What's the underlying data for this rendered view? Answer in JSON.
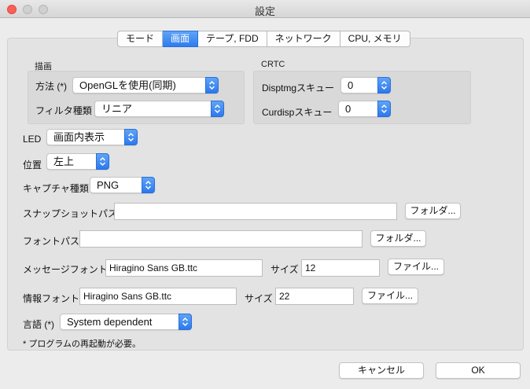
{
  "window": {
    "title": "設定"
  },
  "tabs": [
    {
      "label": "モード",
      "active": false
    },
    {
      "label": "画面",
      "active": true
    },
    {
      "label": "テープ, FDD",
      "active": false
    },
    {
      "label": "ネットワーク",
      "active": false
    },
    {
      "label": "CPU, メモリ",
      "active": false
    }
  ],
  "drawing_group": {
    "title": "描画",
    "method_label": "方法 (*)",
    "method_value": "OpenGLを使用(同期)",
    "filter_label": "フィルタ種類",
    "filter_value": "リニア"
  },
  "crtc_group": {
    "title": "CRTC",
    "disptmg_label": "Disptmgスキュー",
    "disptmg_value": "0",
    "curdisp_label": "Curdispスキュー",
    "curdisp_value": "0"
  },
  "led": {
    "label": "LED",
    "value": "画面内表示"
  },
  "position": {
    "label": "位置",
    "value": "左上"
  },
  "capture": {
    "label": "キャプチャ種類",
    "value": "PNG"
  },
  "snapshot": {
    "label": "スナップショットパス",
    "value": "",
    "button": "フォルダ..."
  },
  "font_path": {
    "label": "フォントパス",
    "value": "",
    "button": "フォルダ..."
  },
  "message_font": {
    "label": "メッセージフォント",
    "value": "Hiragino Sans GB.ttc",
    "size_label": "サイズ",
    "size_value": "12",
    "button": "ファイル..."
  },
  "info_font": {
    "label": "情報フォント",
    "value": "Hiragino Sans GB.ttc",
    "size_label": "サイズ",
    "size_value": "22",
    "button": "ファイル..."
  },
  "language": {
    "label": "言語 (*)",
    "value": "System dependent"
  },
  "note": "* プログラムの再起動が必要。",
  "footer": {
    "cancel": "キャンセル",
    "ok": "OK"
  },
  "colors": {
    "accent": "#2e7cf0",
    "close": "#fc5f57"
  }
}
